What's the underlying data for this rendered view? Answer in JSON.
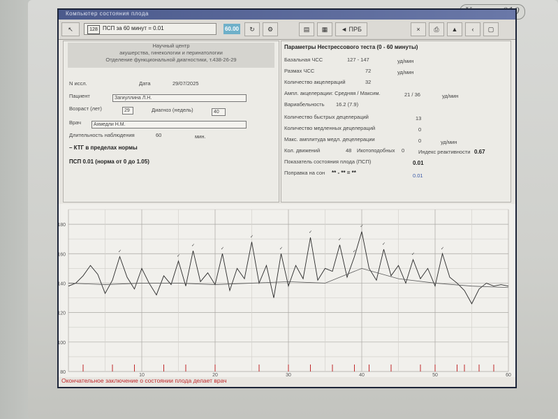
{
  "window": {
    "title": "Компьютер состояния плода"
  },
  "toolbar": {
    "number_box": "128",
    "psp_text": "ПСП за 60 минут = 0.01",
    "sixty_value": "60.00",
    "prb_label": "ПРБ"
  },
  "left": {
    "center_lines": [
      "Научный центр",
      "акушерства, гинекологии и перинатологии",
      "Отделение функциональной диагностики, т.438-26-29"
    ],
    "n_issl_label": "N иссл.",
    "date_label": "Дата",
    "date_value": "29/07/2025",
    "patient_label": "Пациент",
    "patient_value": "Загиуллина Л.Н.",
    "age_label": "Возраст (лет)",
    "age_value": "29",
    "diagnosis_label": "Диагноз (недель)",
    "diagnosis_value": "40",
    "doctor_label": "Врач",
    "doctor_value": "Ахмедли Н.М.",
    "duration_label": "Длительность наблюдения",
    "duration_value": "60",
    "duration_unit": "мин.",
    "conclusion_1": "– КТГ в пределах нормы",
    "conclusion_2": "ПСП 0.01 (норма от 0 до 1.05)"
  },
  "right": {
    "title": "Параметры Нестрессового теста (0 - 60 минуты)",
    "rows": [
      {
        "label": "Базальная ЧСС",
        "value": "127 - 147",
        "unit": "уд/мин"
      },
      {
        "label": "Размах ЧСС",
        "value": "72",
        "unit": "уд/мин"
      },
      {
        "label": "Количество акцелераций",
        "value": "32",
        "unit": ""
      },
      {
        "label": "Ампл. акцелерации: Средняя / Максим.",
        "value": "21  /  36",
        "unit": "уд/мин"
      },
      {
        "label": "Вариабельность",
        "value": "16.2 (7.9)",
        "unit": ""
      },
      {
        "label": "Количество быстрых децелераций",
        "value": "13",
        "unit": ""
      },
      {
        "label": "Количество медленных децелераций",
        "value": "0",
        "unit": ""
      },
      {
        "label": "Макс. амплитуда медл. децелерации",
        "value": "0",
        "unit": "уд/мин"
      }
    ],
    "movements_label": "Кол. движений",
    "movements_value": "48",
    "ikotopod_label": "Икотоподобных",
    "ikotopod_value": "0",
    "reactivity_label": "Индекс реактивности",
    "reactivity_value": "0.67",
    "psp_label": "Показатель состояния плода (ПСП)",
    "psp_value": "0.01",
    "sleep_label": "Поправка на сон",
    "sleep_value": "** - ** = **",
    "sleep_result": "0.01"
  },
  "chart_data": {
    "type": "line",
    "title": "",
    "xlabel": "",
    "ylabel": "",
    "xlim": [
      0,
      60
    ],
    "ylim": [
      80,
      190
    ],
    "x_ticks": [
      10,
      20,
      30,
      40,
      50,
      60
    ],
    "y_ticks": [
      80,
      100,
      120,
      140,
      160,
      180
    ],
    "grid": true,
    "series": [
      {
        "name": "",
        "x": [
          0,
          1,
          2,
          3,
          4,
          5,
          6,
          7,
          8,
          9,
          10,
          11,
          12,
          13,
          14,
          15,
          16,
          17,
          18,
          19,
          20,
          21,
          22,
          23,
          24,
          25,
          26,
          27,
          28,
          29,
          30,
          31,
          32,
          33,
          34,
          35,
          36,
          37,
          38,
          39,
          40,
          41,
          42,
          43,
          44,
          45,
          46,
          47,
          48,
          49,
          50,
          51,
          52,
          53,
          54,
          55,
          56,
          57,
          58,
          59,
          60
        ],
        "y": [
          138,
          140,
          145,
          152,
          146,
          133,
          142,
          158,
          144,
          136,
          150,
          140,
          132,
          145,
          139,
          155,
          138,
          162,
          141,
          147,
          139,
          160,
          135,
          150,
          143,
          168,
          140,
          152,
          130,
          160,
          138,
          152,
          143,
          171,
          142,
          150,
          148,
          166,
          144,
          158,
          175,
          150,
          142,
          163,
          145,
          152,
          140,
          156,
          143,
          150,
          138,
          160,
          144,
          140,
          135,
          126,
          136,
          140,
          138,
          139,
          138
        ]
      },
      {
        "name": "",
        "x": [
          0,
          5,
          10,
          15,
          20,
          25,
          30,
          35,
          40,
          45,
          50,
          55,
          60
        ],
        "y": [
          140,
          139,
          140,
          140,
          139,
          140,
          141,
          140,
          150,
          143,
          140,
          138,
          137
        ]
      }
    ],
    "movement_marks": [
      2,
      6,
      9,
      13,
      16,
      20,
      26,
      30,
      33,
      36,
      39,
      41,
      44,
      48,
      50,
      53,
      54,
      56,
      58
    ]
  },
  "footer": {
    "text": "Окончательное заключение о состоянии плода делает врач"
  },
  "logo": {
    "text": "Уникос 010"
  },
  "colors": {
    "accent": "#6fb0c9",
    "warning": "#c0282a",
    "titlebar": "#4b5a8c"
  }
}
